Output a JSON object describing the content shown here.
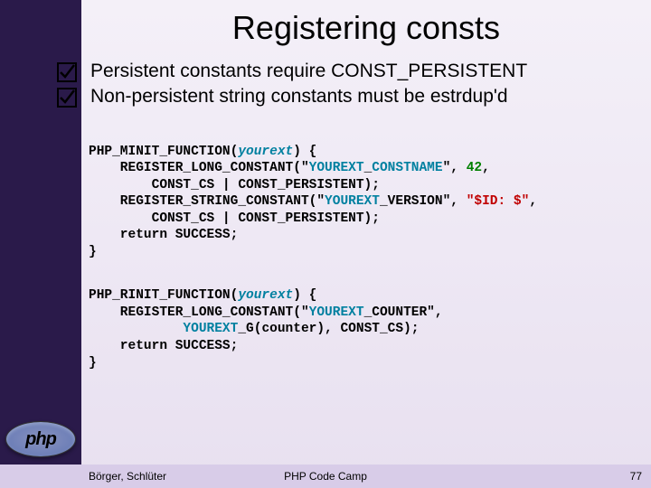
{
  "title": "Registering consts",
  "bullets": [
    "Persistent constants require CONST_PERSISTENT",
    "Non-persistent string constants must be estrdup'd"
  ],
  "code1": {
    "l1a": "PHP_MINIT_FUNCTION(",
    "l1b": "yourext",
    "l1c": ") {",
    "l2a": "    REGISTER_LONG_CONSTANT(\"",
    "l2b": "YOUREXT",
    "l2c": "_",
    "l2d": "CONSTNAME",
    "l2e": "\", ",
    "l2f": "42",
    "l2g": ",",
    "l3": "        CONST_CS | CONST_PERSISTENT);",
    "l4a": "    REGISTER_STRING_CONSTANT(\"",
    "l4b": "YOUREXT",
    "l4c": "_VERSION\", ",
    "l4d": "\"$ID: $\"",
    "l4e": ",",
    "l5": "        CONST_CS | CONST_PERSISTENT);",
    "l6": "    return SUCCESS;",
    "l7": "}"
  },
  "code2": {
    "l1a": "PHP_RINIT_FUNCTION(",
    "l1b": "yourext",
    "l1c": ") {",
    "l2a": "    REGISTER_LONG_CONSTANT(\"",
    "l2b": "YOUREXT",
    "l2c": "_COUNTER\",",
    "l3a": "            ",
    "l3b": "YOUREXT",
    "l3c": "_G(counter), CONST_CS);",
    "l4": "    return SUCCESS;",
    "l5": "}"
  },
  "footer": {
    "authors": "Börger, Schlüter",
    "camp": "PHP Code Camp",
    "page": "77"
  },
  "logo": "php"
}
